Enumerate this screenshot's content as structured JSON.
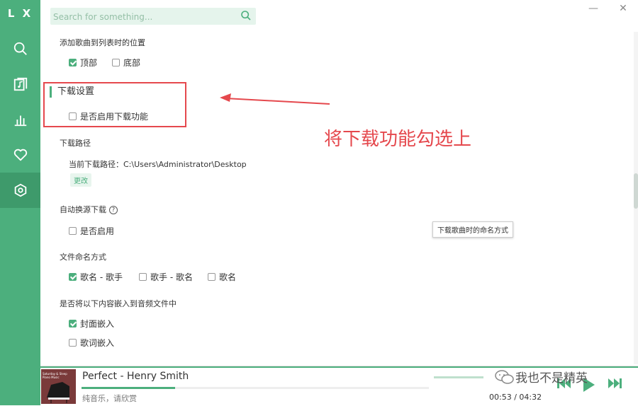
{
  "app": {
    "logo": "L X"
  },
  "search": {
    "placeholder": "Search for something..."
  },
  "settings": {
    "add_position": {
      "title": "添加歌曲到列表时的位置",
      "options": [
        "顶部",
        "底部"
      ],
      "checked": [
        true,
        false
      ]
    },
    "download": {
      "section_title": "下载设置",
      "enable_label": "是否启用下载功能",
      "enable_checked": false
    },
    "download_path": {
      "title": "下载路径",
      "label": "当前下载路径：",
      "value": "C:\\Users\\Administrator\\Desktop",
      "change_label": "更改"
    },
    "auto_switch": {
      "title": "自动换源下载",
      "help": "?",
      "enable_label": "是否启用",
      "enable_checked": false
    },
    "tooltip": "下载歌曲时的命名方式",
    "file_naming": {
      "title": "文件命名方式",
      "options": [
        "歌名 - 歌手",
        "歌手 - 歌名",
        "歌名"
      ],
      "checked": [
        true,
        false,
        false
      ]
    },
    "embed": {
      "title": "是否将以下内容嵌入到音频文件中",
      "options": [
        "封面嵌入",
        "歌词嵌入"
      ],
      "checked": [
        true,
        false
      ]
    }
  },
  "annotation": {
    "text": "将下载功能勾选上",
    "color": "#e5484d"
  },
  "player": {
    "cover_text": "Saturday & Sleep Piano Music",
    "song_title": "Perfect - Henry Smith",
    "subtitle": "纯音乐，请欣赏",
    "progress": 0.27,
    "time": "00:53 / 04:32"
  },
  "watermark": "我也不是精英",
  "colors": {
    "accent": "#4caf7d",
    "annotation": "#e5484d"
  }
}
